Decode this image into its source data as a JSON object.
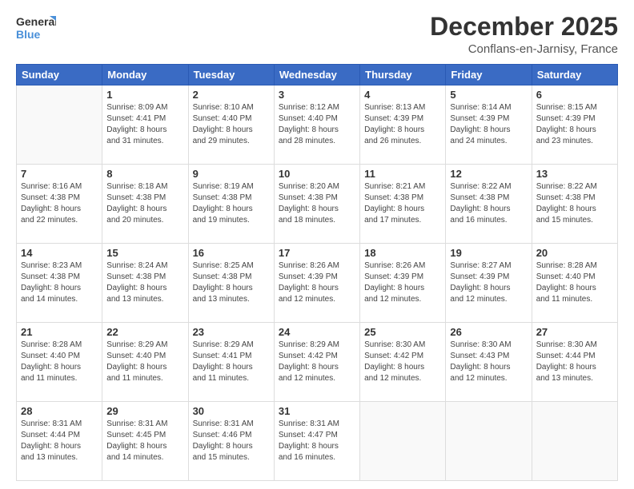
{
  "logo": {
    "line1": "General",
    "line2": "Blue"
  },
  "title": "December 2025",
  "location": "Conflans-en-Jarnisy, France",
  "days_header": [
    "Sunday",
    "Monday",
    "Tuesday",
    "Wednesday",
    "Thursday",
    "Friday",
    "Saturday"
  ],
  "weeks": [
    [
      {
        "day": "",
        "info": ""
      },
      {
        "day": "1",
        "info": "Sunrise: 8:09 AM\nSunset: 4:41 PM\nDaylight: 8 hours\nand 31 minutes."
      },
      {
        "day": "2",
        "info": "Sunrise: 8:10 AM\nSunset: 4:40 PM\nDaylight: 8 hours\nand 29 minutes."
      },
      {
        "day": "3",
        "info": "Sunrise: 8:12 AM\nSunset: 4:40 PM\nDaylight: 8 hours\nand 28 minutes."
      },
      {
        "day": "4",
        "info": "Sunrise: 8:13 AM\nSunset: 4:39 PM\nDaylight: 8 hours\nand 26 minutes."
      },
      {
        "day": "5",
        "info": "Sunrise: 8:14 AM\nSunset: 4:39 PM\nDaylight: 8 hours\nand 24 minutes."
      },
      {
        "day": "6",
        "info": "Sunrise: 8:15 AM\nSunset: 4:39 PM\nDaylight: 8 hours\nand 23 minutes."
      }
    ],
    [
      {
        "day": "7",
        "info": "Sunrise: 8:16 AM\nSunset: 4:38 PM\nDaylight: 8 hours\nand 22 minutes."
      },
      {
        "day": "8",
        "info": "Sunrise: 8:18 AM\nSunset: 4:38 PM\nDaylight: 8 hours\nand 20 minutes."
      },
      {
        "day": "9",
        "info": "Sunrise: 8:19 AM\nSunset: 4:38 PM\nDaylight: 8 hours\nand 19 minutes."
      },
      {
        "day": "10",
        "info": "Sunrise: 8:20 AM\nSunset: 4:38 PM\nDaylight: 8 hours\nand 18 minutes."
      },
      {
        "day": "11",
        "info": "Sunrise: 8:21 AM\nSunset: 4:38 PM\nDaylight: 8 hours\nand 17 minutes."
      },
      {
        "day": "12",
        "info": "Sunrise: 8:22 AM\nSunset: 4:38 PM\nDaylight: 8 hours\nand 16 minutes."
      },
      {
        "day": "13",
        "info": "Sunrise: 8:22 AM\nSunset: 4:38 PM\nDaylight: 8 hours\nand 15 minutes."
      }
    ],
    [
      {
        "day": "14",
        "info": "Sunrise: 8:23 AM\nSunset: 4:38 PM\nDaylight: 8 hours\nand 14 minutes."
      },
      {
        "day": "15",
        "info": "Sunrise: 8:24 AM\nSunset: 4:38 PM\nDaylight: 8 hours\nand 13 minutes."
      },
      {
        "day": "16",
        "info": "Sunrise: 8:25 AM\nSunset: 4:38 PM\nDaylight: 8 hours\nand 13 minutes."
      },
      {
        "day": "17",
        "info": "Sunrise: 8:26 AM\nSunset: 4:39 PM\nDaylight: 8 hours\nand 12 minutes."
      },
      {
        "day": "18",
        "info": "Sunrise: 8:26 AM\nSunset: 4:39 PM\nDaylight: 8 hours\nand 12 minutes."
      },
      {
        "day": "19",
        "info": "Sunrise: 8:27 AM\nSunset: 4:39 PM\nDaylight: 8 hours\nand 12 minutes."
      },
      {
        "day": "20",
        "info": "Sunrise: 8:28 AM\nSunset: 4:40 PM\nDaylight: 8 hours\nand 11 minutes."
      }
    ],
    [
      {
        "day": "21",
        "info": "Sunrise: 8:28 AM\nSunset: 4:40 PM\nDaylight: 8 hours\nand 11 minutes."
      },
      {
        "day": "22",
        "info": "Sunrise: 8:29 AM\nSunset: 4:40 PM\nDaylight: 8 hours\nand 11 minutes."
      },
      {
        "day": "23",
        "info": "Sunrise: 8:29 AM\nSunset: 4:41 PM\nDaylight: 8 hours\nand 11 minutes."
      },
      {
        "day": "24",
        "info": "Sunrise: 8:29 AM\nSunset: 4:42 PM\nDaylight: 8 hours\nand 12 minutes."
      },
      {
        "day": "25",
        "info": "Sunrise: 8:30 AM\nSunset: 4:42 PM\nDaylight: 8 hours\nand 12 minutes."
      },
      {
        "day": "26",
        "info": "Sunrise: 8:30 AM\nSunset: 4:43 PM\nDaylight: 8 hours\nand 12 minutes."
      },
      {
        "day": "27",
        "info": "Sunrise: 8:30 AM\nSunset: 4:44 PM\nDaylight: 8 hours\nand 13 minutes."
      }
    ],
    [
      {
        "day": "28",
        "info": "Sunrise: 8:31 AM\nSunset: 4:44 PM\nDaylight: 8 hours\nand 13 minutes."
      },
      {
        "day": "29",
        "info": "Sunrise: 8:31 AM\nSunset: 4:45 PM\nDaylight: 8 hours\nand 14 minutes."
      },
      {
        "day": "30",
        "info": "Sunrise: 8:31 AM\nSunset: 4:46 PM\nDaylight: 8 hours\nand 15 minutes."
      },
      {
        "day": "31",
        "info": "Sunrise: 8:31 AM\nSunset: 4:47 PM\nDaylight: 8 hours\nand 16 minutes."
      },
      {
        "day": "",
        "info": ""
      },
      {
        "day": "",
        "info": ""
      },
      {
        "day": "",
        "info": ""
      }
    ]
  ]
}
